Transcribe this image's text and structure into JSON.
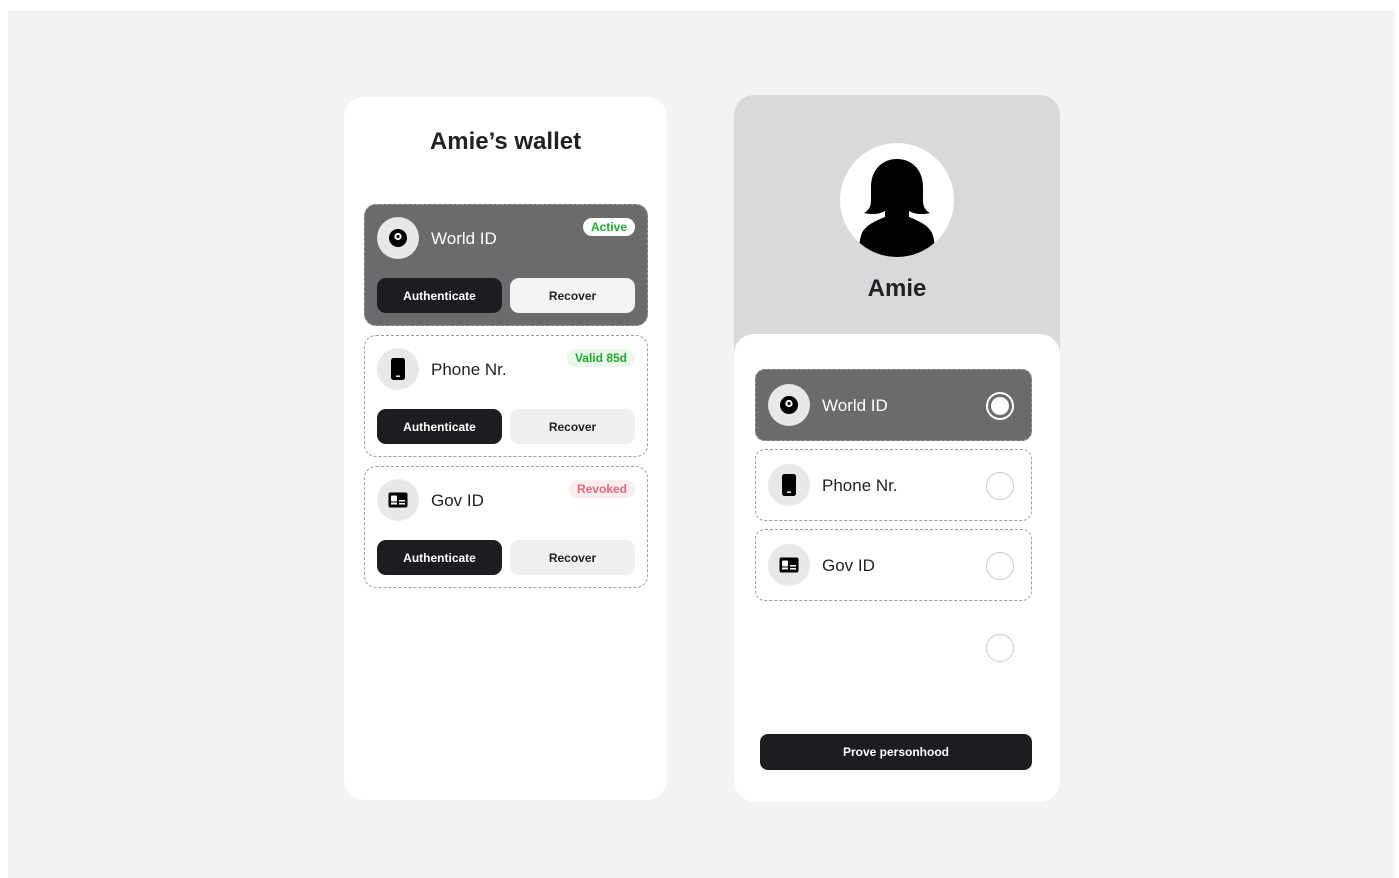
{
  "wallet": {
    "title": "Amie’s wallet",
    "credentials": [
      {
        "name": "World ID",
        "icon": "orb-icon",
        "status": "Active",
        "status_color": "#1faa2f",
        "auth_label": "Authenticate",
        "recover_label": "Recover",
        "active": true
      },
      {
        "name": "Phone Nr.",
        "icon": "phone-icon",
        "status": "Valid 85d",
        "status_color": "#1faa2f",
        "auth_label": "Authenticate",
        "recover_label": "Recover",
        "active": false
      },
      {
        "name": "Gov ID",
        "icon": "id-card-icon",
        "status": "Revoked",
        "status_color": "#e8667d",
        "auth_label": "Authenticate",
        "recover_label": "Recover",
        "active": false
      }
    ]
  },
  "profile": {
    "name": "Amie",
    "options": [
      {
        "name": "World ID",
        "icon": "orb-icon",
        "selected": true
      },
      {
        "name": "Phone Nr.",
        "icon": "phone-icon",
        "selected": false
      },
      {
        "name": "Gov ID",
        "icon": "id-card-icon",
        "selected": false
      }
    ],
    "prove_label": "Prove personhood"
  },
  "colors": {
    "background": "#f3f3f3",
    "card": "#ffffff",
    "active_card": "#6b6b6b",
    "primary_button": "#1b1d20",
    "secondary_button": "#efefef",
    "profile_header": "#d9d9d9"
  }
}
